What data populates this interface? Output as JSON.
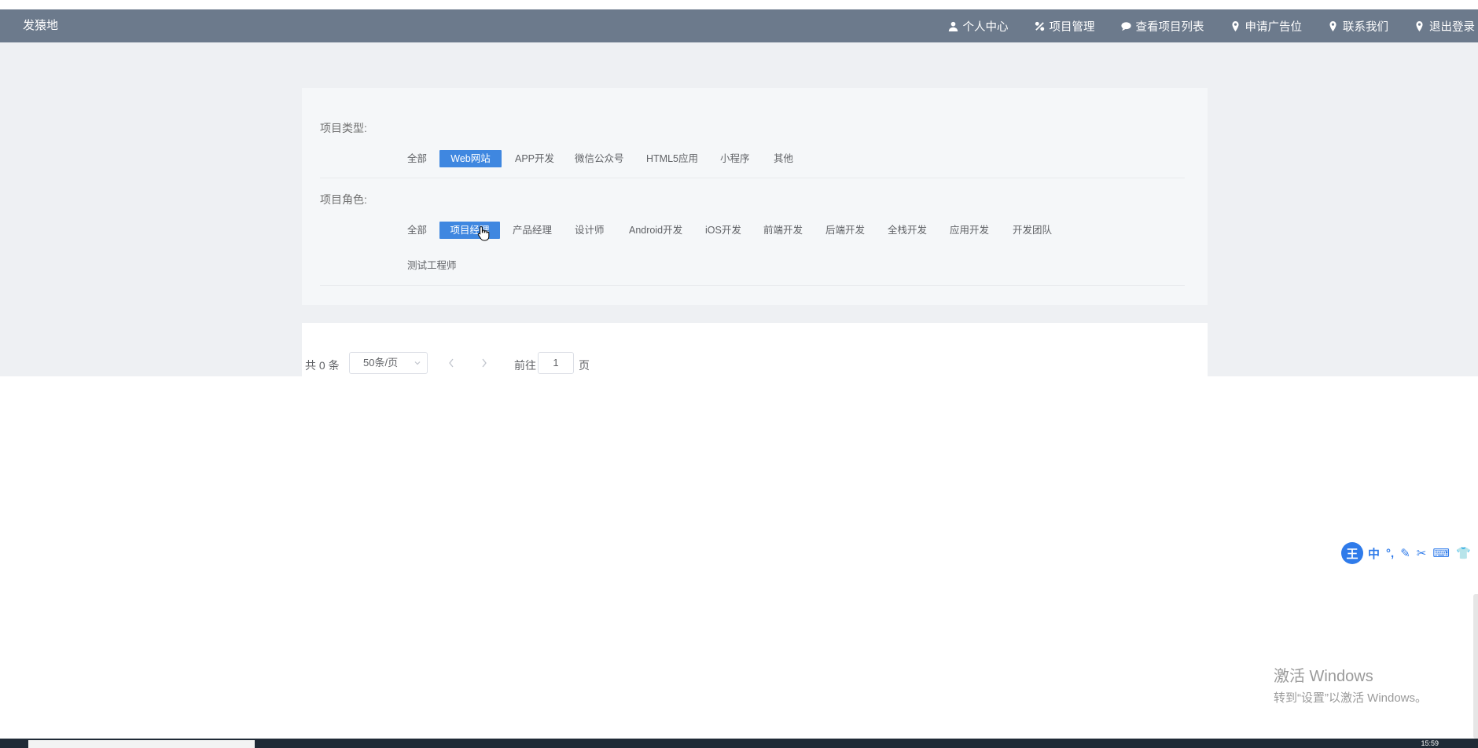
{
  "brand": "发猿地",
  "nav": [
    {
      "label": "个人中心",
      "icon": "user-icon"
    },
    {
      "label": "项目管理",
      "icon": "percent-icon"
    },
    {
      "label": "查看项目列表",
      "icon": "comment-icon"
    },
    {
      "label": "申请广告位",
      "icon": "map-pin-icon"
    },
    {
      "label": "联系我们",
      "icon": "map-pin-icon"
    },
    {
      "label": "退出登录",
      "icon": "map-pin-icon"
    }
  ],
  "filters": {
    "type_label": "项目类型:",
    "type_options": [
      "全部",
      "Web网站",
      "APP开发",
      "微信公众号",
      "HTML5应用",
      "小程序",
      "其他"
    ],
    "type_selected": "Web网站",
    "role_label": "项目角色:",
    "role_options": [
      "全部",
      "项目经理",
      "产品经理",
      "设计师",
      "Android开发",
      "iOS开发",
      "前端开发",
      "后端开发",
      "全栈开发",
      "应用开发",
      "开发团队",
      "测试工程师"
    ],
    "role_selected": "项目经理"
  },
  "pagination": {
    "total_text": "共 0 条",
    "page_size": "50条/页",
    "goto_prefix": "前往",
    "current_page": "1",
    "goto_suffix": "页"
  },
  "ime": {
    "logo": "王",
    "mode": "中"
  },
  "watermark": {
    "title": "激活 Windows",
    "subtitle": "转到“设置”以激活 Windows。"
  },
  "taskbar": {
    "clock": "15:59"
  },
  "colors": {
    "navbar": "#6c7a8c",
    "accent": "#3f87e0",
    "page_bg": "#eef0f3"
  }
}
